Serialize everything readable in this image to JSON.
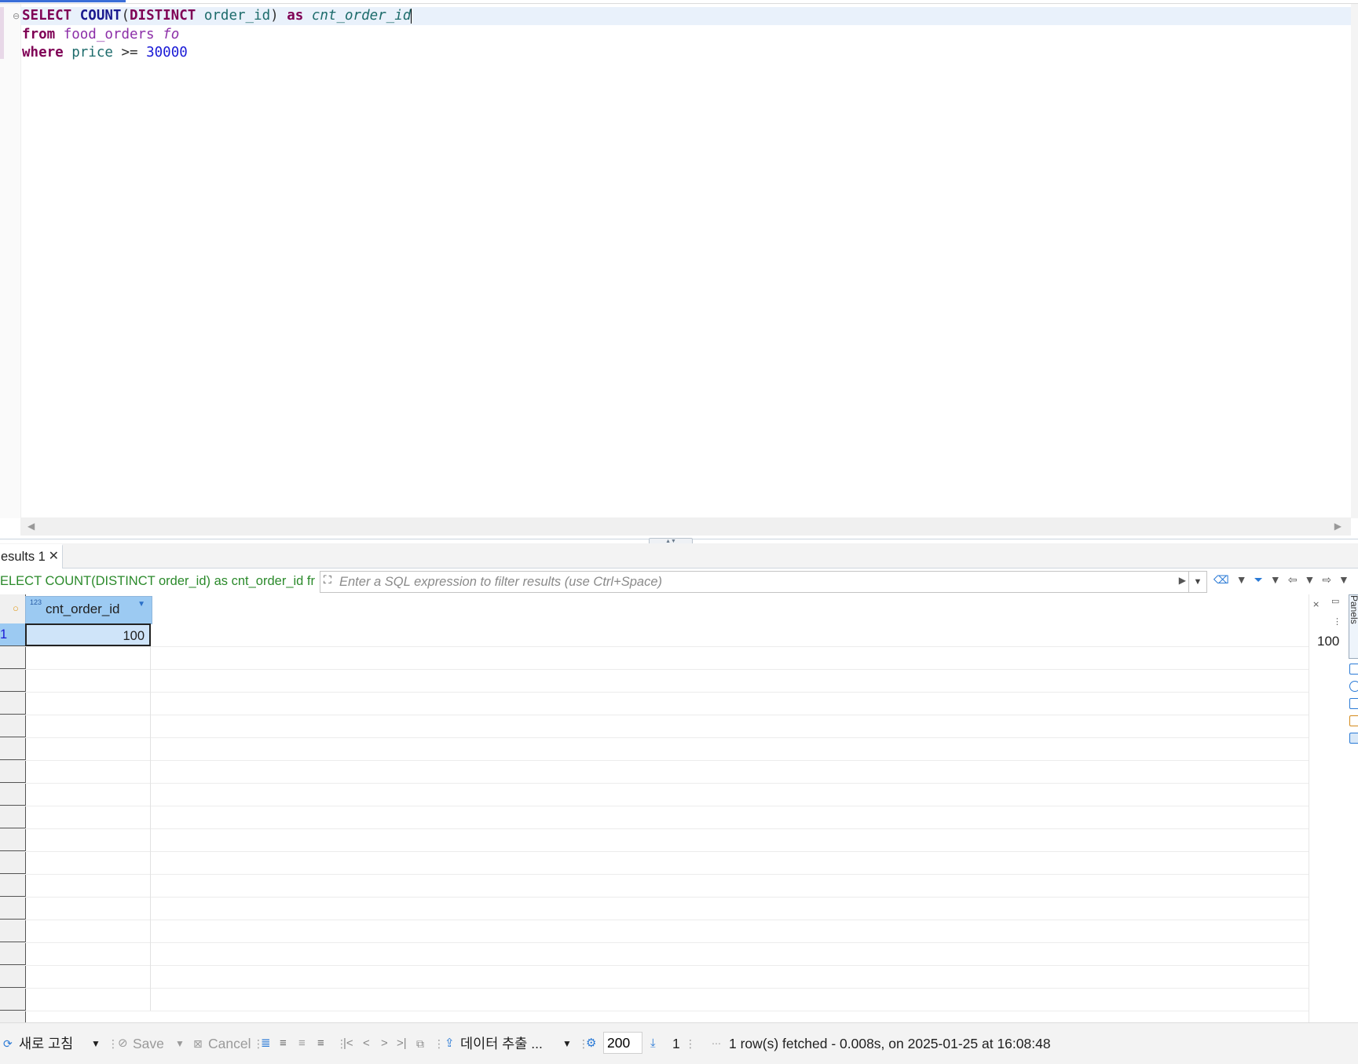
{
  "editor": {
    "lines": [
      {
        "t1": "SELECT",
        "t2": "COUNT",
        "t3": "(",
        "t4": "DISTINCT",
        "t5": "order_id",
        "t6": ")",
        "t7": "as",
        "t8": "cnt_order_id"
      },
      {
        "t1": "from",
        "t2": "food_orders",
        "t3": "fo"
      },
      {
        "t1": "where",
        "t2": "price",
        "t3": ">=",
        "t4": "30000"
      }
    ]
  },
  "results": {
    "tab_label": "esults 1",
    "tab_close": "✕",
    "query_text": "ELECT COUNT(DISTINCT order_id) as cnt_order_id fr",
    "filter_placeholder": "Enter a SQL expression to filter results (use Ctrl+Space)",
    "column": {
      "type_badge": "123",
      "name": "cnt_order_id"
    },
    "rows": [
      {
        "num": "1",
        "value": "100"
      }
    ],
    "side_value": "100",
    "panels_label": "Panels"
  },
  "status": {
    "refresh_label": "새로 고침",
    "save_label": "Save",
    "cancel_label": "Cancel",
    "export_label": "데이터 추출 ...",
    "fetch_size": "200",
    "row_count": "1",
    "fetch_message": "1 row(s) fetched - 0.008s, on 2025-01-25 at 16:08:48"
  }
}
